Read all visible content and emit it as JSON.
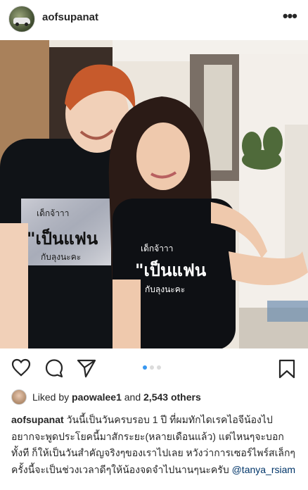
{
  "post": {
    "username": "aofsupanat",
    "more_icon": "more-horizontal-icon",
    "shirt_print": {
      "small": "เด็กจ้าาา",
      "big": "\"เป็นแฟน",
      "bottom": "กับลุงนะคะ"
    }
  },
  "actions": {
    "like_icon": "heart-icon",
    "comment_icon": "comment-icon",
    "share_icon": "send-icon",
    "save_icon": "bookmark-icon",
    "carousel_dots": 3,
    "active_dot": 1
  },
  "likes": {
    "prefix": "Liked by",
    "user": "paowalee1",
    "middle": "and",
    "count": "2,543 others"
  },
  "caption": {
    "username": "aofsupanat",
    "text": "วันนี้เป็นวันครบรอบ 1 ปี ที่ผมทักไดเรคไอจีน้องไป อยากจะพูดประโยคนี้มาสักระยะ(หลายเดือนแล้ว) แต่ไหนๆจะบอกทั้งที ก็ให้เป็นวันสำคัญจริงๆของเราไปเลย หวังว่าการเซอร์ไพร์สเล็กๆครั้งนี้จะเป็นช่วงเวลาดีๆให้น้องจดจำไปนานๆนะครับ",
    "mention": "@tanya_rsiam"
  },
  "colors": {
    "accent": "#3897f0",
    "text": "#262626",
    "mention": "#003569"
  }
}
